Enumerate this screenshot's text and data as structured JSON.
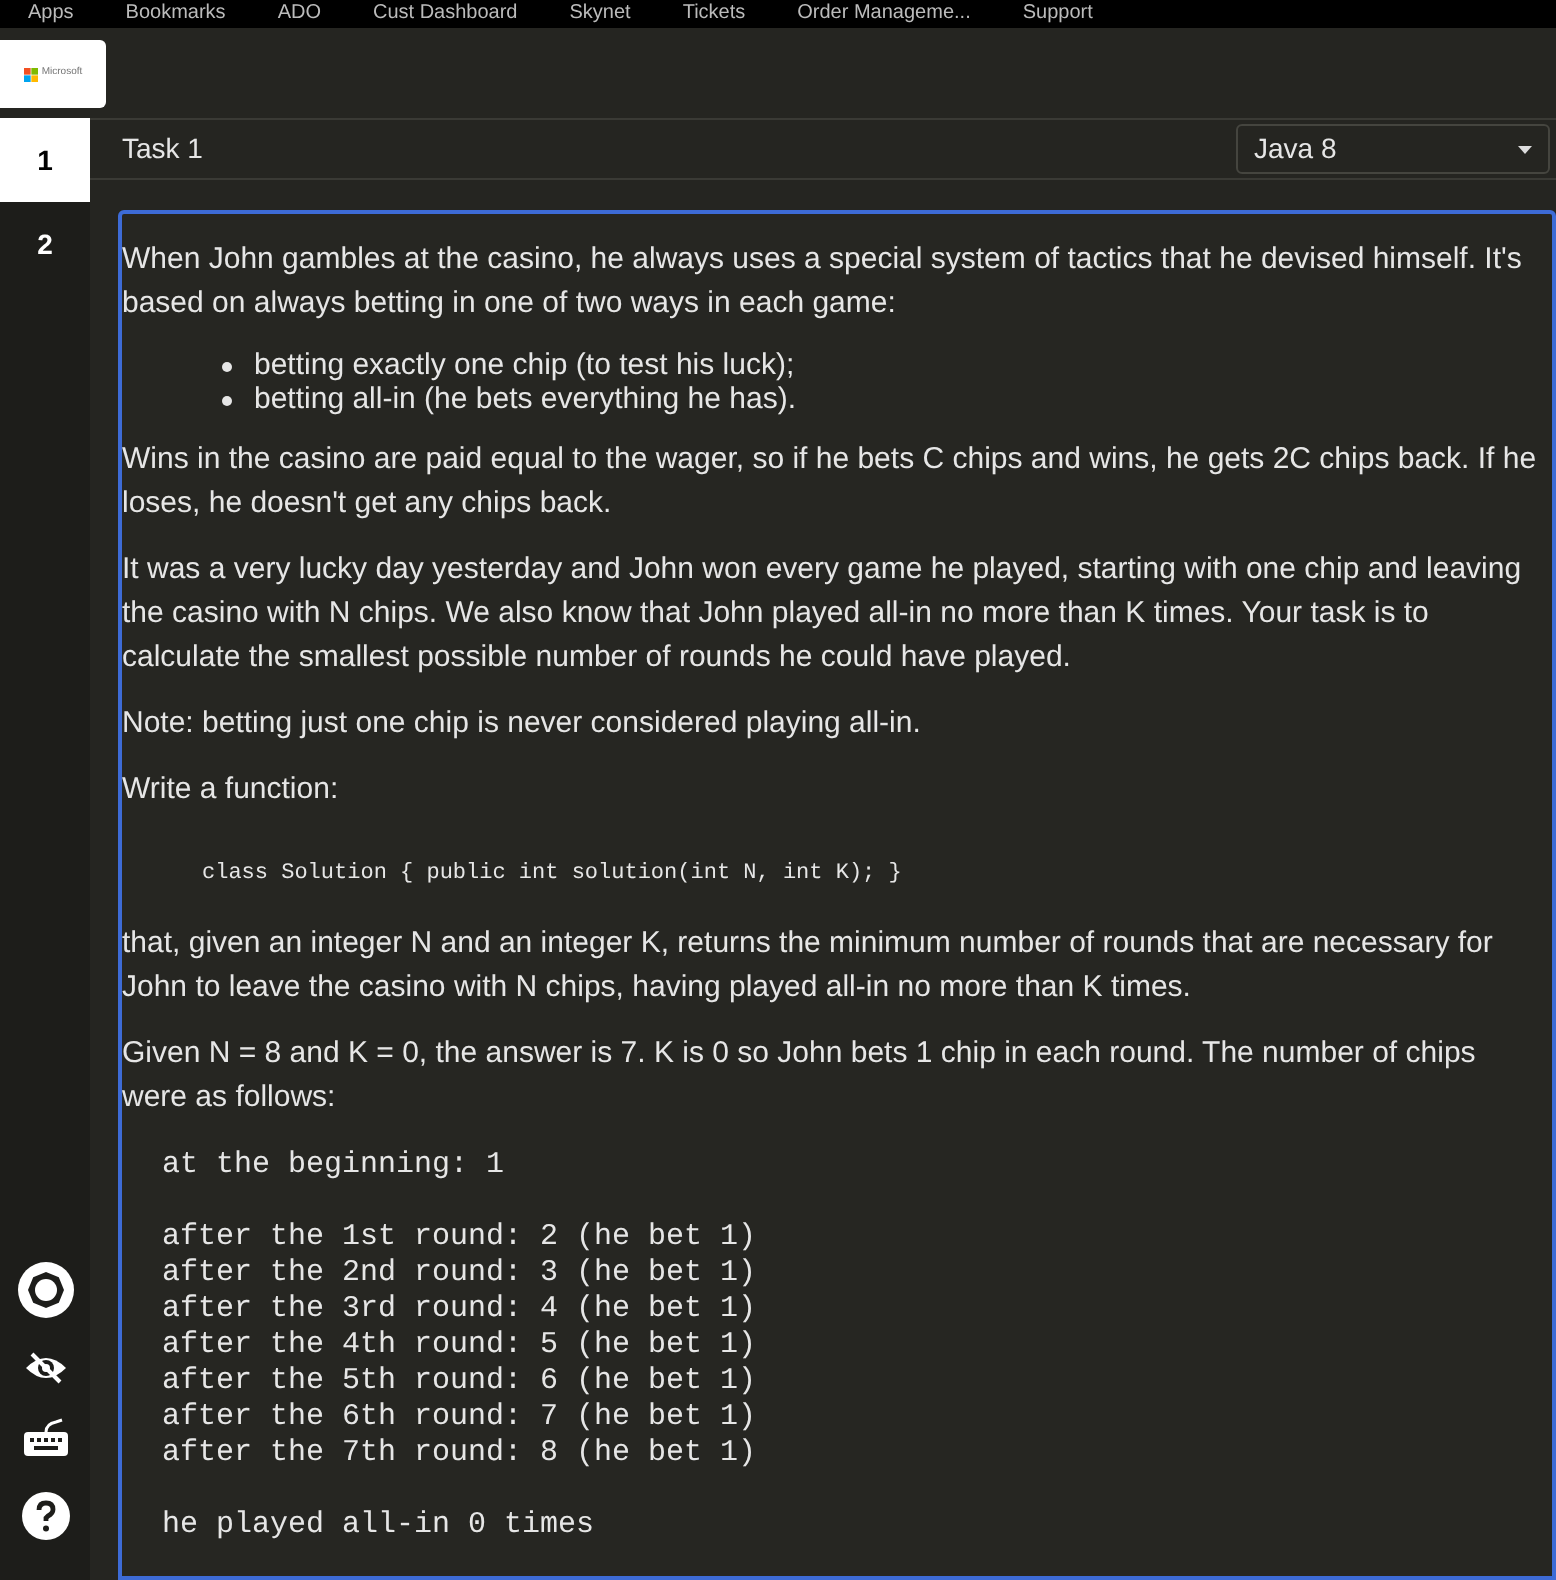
{
  "bookmarks": [
    {
      "label": "Apps"
    },
    {
      "label": "Bookmarks"
    },
    {
      "label": "ADO"
    },
    {
      "label": "Cust Dashboard"
    },
    {
      "label": "Skynet"
    },
    {
      "label": "Tickets"
    },
    {
      "label": "Order Manageme..."
    },
    {
      "label": "Support"
    }
  ],
  "logo": {
    "text": "Microsoft"
  },
  "task_tabs": [
    {
      "label": "1",
      "selected": true
    },
    {
      "label": "2",
      "selected": false
    }
  ],
  "task": {
    "title": "Task 1",
    "language": "Java 8"
  },
  "content": [
    {
      "kind": "paragraph",
      "text": "When John gambles at the casino, he always uses a special system of tactics that he devised himself. It's based on always betting in one of two ways in each game:"
    },
    {
      "kind": "list",
      "items": [
        "betting exactly one chip (to test his luck);",
        "betting all-in (he bets everything he has)."
      ]
    },
    {
      "kind": "paragraph",
      "text": "Wins in the casino are paid equal to the wager, so if he bets C chips and wins, he gets 2C chips back. If he loses, he doesn't get any chips back."
    },
    {
      "kind": "paragraph",
      "text": "It was a very lucky day yesterday and John won every game he played, starting with one chip and leaving the casino with N chips. We also know that John played all-in no more than K times. Your task is to calculate the smallest possible number of rounds he could have played."
    },
    {
      "kind": "paragraph",
      "text": "Note: betting just one chip is never considered playing all-in."
    },
    {
      "kind": "paragraph",
      "text": "Write a function:"
    },
    {
      "kind": "code",
      "text": "class Solution { public int solution(int N, int K); }"
    },
    {
      "kind": "paragraph",
      "text": "that, given an integer N and an integer K, returns the minimum number of rounds that are necessary for John to leave the casino with N chips, having played all-in no more than K times."
    },
    {
      "kind": "paragraph",
      "text": "Given N = 8 and K = 0, the answer is 7. K is 0 so John bets 1 chip in each round. The number of chips were as follows:"
    },
    {
      "kind": "pre",
      "groups": [
        [
          "at the beginning: 1"
        ],
        [
          "after the 1st round: 2 (he bet 1)",
          "after the 2nd round: 3 (he bet 1)",
          "after the 3rd round: 4 (he bet 1)",
          "after the 4th round: 5 (he bet 1)",
          "after the 5th round: 6 (he bet 1)",
          "after the 6th round: 7 (he bet 1)",
          "after the 7th round: 8 (he bet 1)"
        ],
        [
          "he played all-in 0 times"
        ]
      ]
    }
  ]
}
